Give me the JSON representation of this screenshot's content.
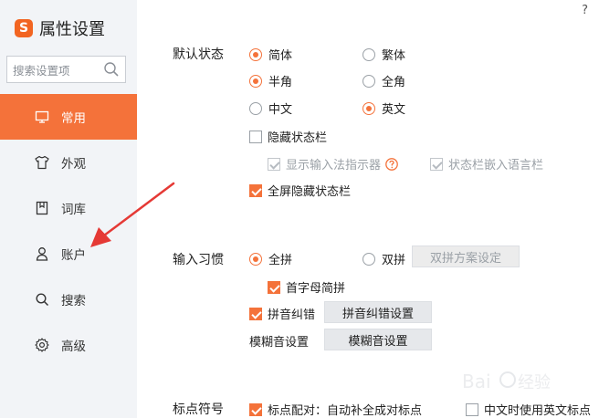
{
  "app": {
    "title": "属性设置",
    "logo_letter": "S"
  },
  "help": {
    "label": "?"
  },
  "search": {
    "placeholder": "搜索设置项"
  },
  "sidebar": {
    "items": [
      {
        "label": "常用",
        "icon": "monitor-icon",
        "active": true
      },
      {
        "label": "外观",
        "icon": "shirt-icon"
      },
      {
        "label": "词库",
        "icon": "book-icon"
      },
      {
        "label": "账户",
        "icon": "user-icon"
      },
      {
        "label": "搜索",
        "icon": "search-icon"
      },
      {
        "label": "高级",
        "icon": "gear-icon"
      }
    ]
  },
  "default_state": {
    "label": "默认状态",
    "simplified": "简体",
    "traditional": "繁体",
    "half_width": "半角",
    "full_width": "全角",
    "chinese": "中文",
    "english": "英文",
    "hide_status_bar": "隐藏状态栏",
    "show_indicator": "显示输入法指示器",
    "embed_language_bar": "状态栏嵌入语言栏",
    "fullscreen_hide": "全屏隐藏状态栏"
  },
  "input_habit": {
    "label": "输入习惯",
    "full_pinyin": "全拼",
    "double_pinyin": "双拼",
    "double_pinyin_settings": "双拼方案设定",
    "initial_abbrev": "首字母简拼",
    "pinyin_correction": "拼音纠错",
    "pinyin_correction_settings": "拼音纠错设置",
    "fuzzy_label": "模糊音设置",
    "fuzzy_settings": "模糊音设置"
  },
  "punctuation": {
    "label": "标点符号",
    "auto_pair": "标点配对：自动补全成对标点",
    "english_punct": "中文时使用英文标点"
  },
  "colors": {
    "accent": "#f4723a",
    "sidebar_bg": "#f2f4f7",
    "annotation_arrow": "#e53935"
  }
}
